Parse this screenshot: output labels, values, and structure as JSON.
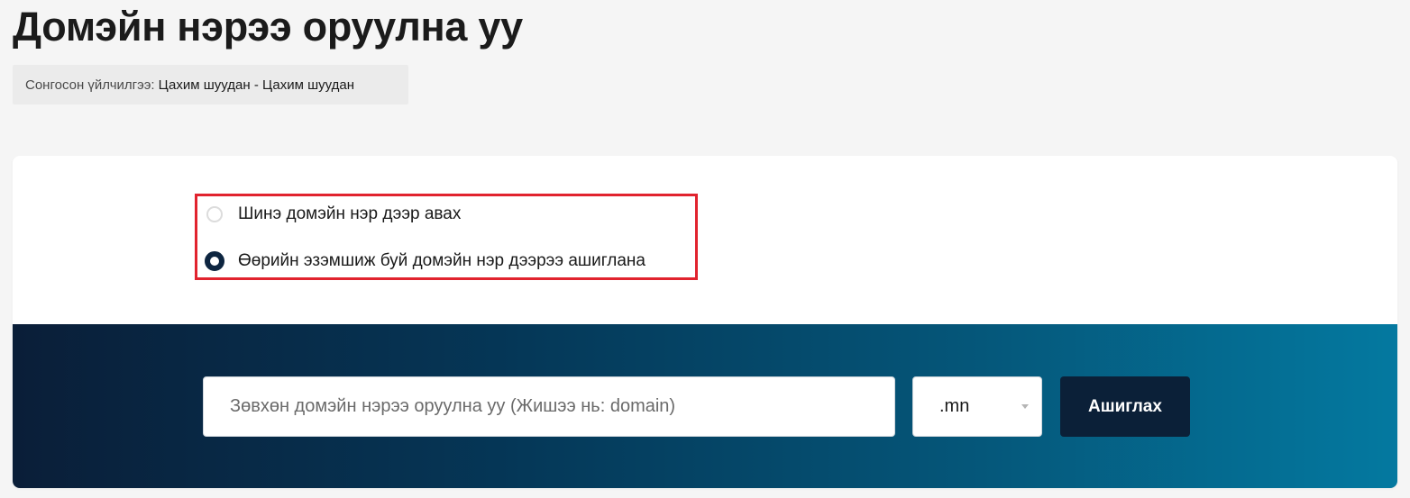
{
  "page": {
    "title": "Домэйн нэрээ оруулна уу"
  },
  "selected_service": {
    "label": "Сонгосон үйлчилгээ:",
    "value": "Цахим шуудан - Цахим шуудан"
  },
  "domain_options": {
    "items": [
      {
        "label": "Шинэ домэйн нэр дээр авах",
        "checked": false
      },
      {
        "label": "Өөрийн эзэмшиж буй домэйн нэр дээрээ ашиглана",
        "checked": true
      }
    ]
  },
  "search": {
    "placeholder": "Зөвхөн домэйн нэрээ оруулна уу (Жишээ нь: domain)",
    "value": "",
    "tld_selected": ".mn",
    "button_label": "Ашиглах"
  },
  "colors": {
    "highlight_border": "#e1232e",
    "button_bg": "#0b2038",
    "radio_checked": "#0d2540",
    "band_gradient_start": "#0a1e38",
    "band_gradient_end": "#0479a0"
  }
}
